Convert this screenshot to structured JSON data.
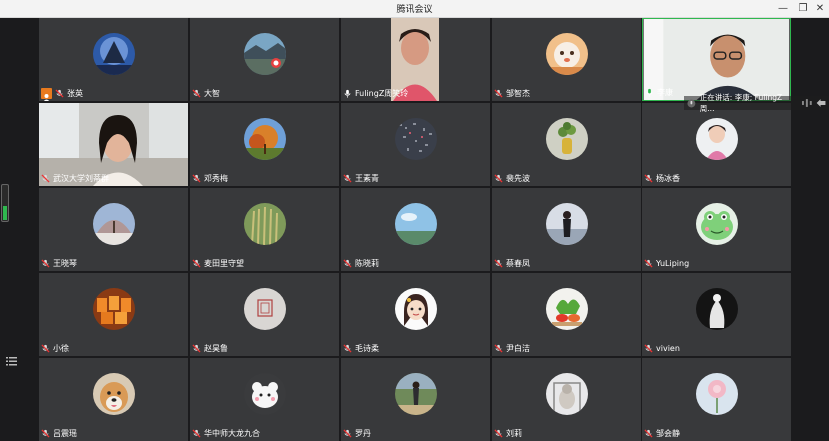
{
  "window": {
    "title": "腾讯会议"
  },
  "speaking": {
    "text": "正在讲话: 李康; FulingZ周..."
  },
  "participants": [
    {
      "name": "张英"
    },
    {
      "name": "大智"
    },
    {
      "name": "FulingZ周笑玲"
    },
    {
      "name": "邹智杰"
    },
    {
      "name": "李康"
    },
    {
      "name": "武汉大学刘蒂群"
    },
    {
      "name": "邓秀梅"
    },
    {
      "name": "王素青"
    },
    {
      "name": "裴先波"
    },
    {
      "name": "杨冰香"
    },
    {
      "name": "王晓琴"
    },
    {
      "name": "麦田里守望"
    },
    {
      "name": "陈晓莉"
    },
    {
      "name": "蔡春凤"
    },
    {
      "name": "YuLiping"
    },
    {
      "name": "小徐"
    },
    {
      "name": "赵昊鲁"
    },
    {
      "name": "毛诗柔"
    },
    {
      "name": "尹白洁"
    },
    {
      "name": "vivien"
    },
    {
      "name": "吕震瑶"
    },
    {
      "name": "华中师大龙九合"
    },
    {
      "name": "罗丹"
    },
    {
      "name": "刘莉"
    },
    {
      "name": "邹会静"
    }
  ]
}
